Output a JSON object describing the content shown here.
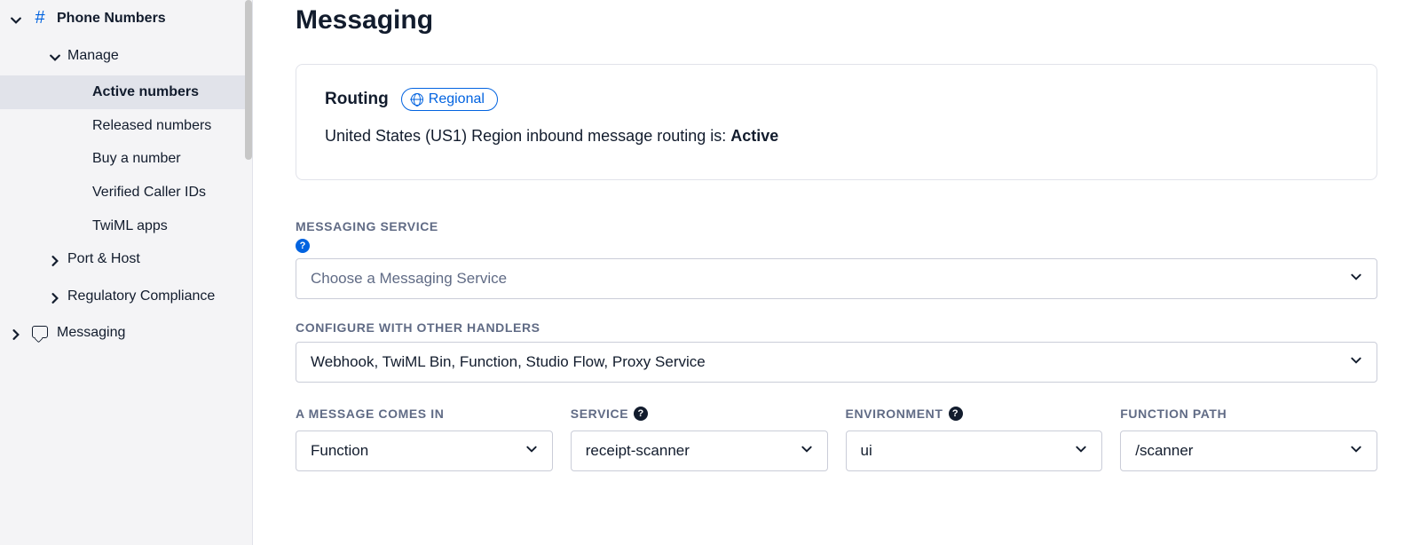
{
  "sidebar": {
    "phoneNumbers": {
      "label": "Phone Numbers"
    },
    "manage": {
      "label": "Manage",
      "items": {
        "active": "Active numbers",
        "released": "Released numbers",
        "buy": "Buy a number",
        "verified": "Verified Caller IDs",
        "twiml": "TwiML apps"
      }
    },
    "portHost": {
      "label": "Port & Host"
    },
    "regulatory": {
      "label": "Regulatory Compliance"
    },
    "messaging": {
      "label": "Messaging"
    }
  },
  "main": {
    "title": "Messaging",
    "routing": {
      "title": "Routing",
      "badge": "Regional",
      "textPrefix": "United States (US1) Region inbound message routing is: ",
      "status": "Active"
    },
    "messagingService": {
      "label": "Messaging Service",
      "placeholder": "Choose a Messaging Service"
    },
    "configureHandlers": {
      "label": "Configure with other handlers",
      "value": "Webhook, TwiML Bin, Function, Studio Flow, Proxy Service"
    },
    "messageIn": {
      "label": "A message comes in",
      "value": "Function"
    },
    "service": {
      "label": "Service",
      "value": "receipt-scanner"
    },
    "environment": {
      "label": "Environment",
      "value": "ui"
    },
    "functionPath": {
      "label": "Function Path",
      "value": "/scanner"
    }
  }
}
